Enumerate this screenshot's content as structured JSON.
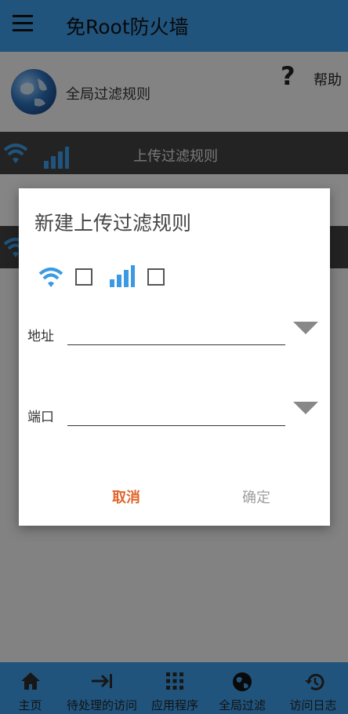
{
  "appbar": {
    "title": "免Root防火墙"
  },
  "global": {
    "label": "全局过滤规则",
    "help": "帮助",
    "help_symbol": "?"
  },
  "bars": {
    "upload_rules": "上传过滤规则"
  },
  "dialog": {
    "title": "新建上传过滤规则",
    "address_label": "地址",
    "address_value": "",
    "port_label": "端口",
    "port_value": "",
    "cancel": "取消",
    "confirm": "确定"
  },
  "bottom_nav": {
    "items": [
      {
        "label": "主页",
        "icon": "home-icon"
      },
      {
        "label": "待处理的访问",
        "icon": "arrow-to-bar-icon"
      },
      {
        "label": "应用程序",
        "icon": "grid-apps-icon"
      },
      {
        "label": "全局过滤",
        "icon": "globe-icon"
      },
      {
        "label": "访问日志",
        "icon": "history-icon"
      }
    ]
  },
  "colors": {
    "primary": "#3b9ae3",
    "accent_cancel": "#e0642a",
    "disabled": "#9e9e9e",
    "dark_bar": "#404040"
  }
}
